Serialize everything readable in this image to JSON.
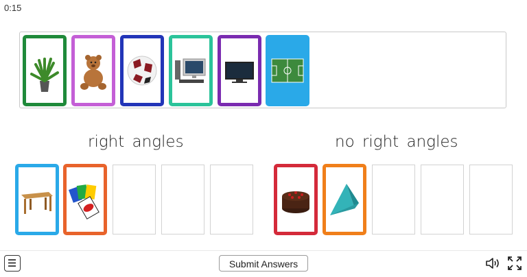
{
  "timer": "0:15",
  "categories": {
    "left_title": "right angles",
    "right_title": "no right angles"
  },
  "pool_cards": [
    {
      "name": "plant",
      "border": "#1f8a3a"
    },
    {
      "name": "teddy-bear",
      "border": "#c45fd6"
    },
    {
      "name": "soccer-ball",
      "border": "#2235b8"
    },
    {
      "name": "desktop-computer",
      "border": "#2bc39a"
    },
    {
      "name": "flat-screen-tv",
      "border": "#7a2bb0"
    },
    {
      "name": "soccer-field",
      "border": "#2aa9e8"
    }
  ],
  "right_angles_cards": [
    {
      "name": "wooden-table",
      "border": "#2aa9e8"
    },
    {
      "name": "uno-cards",
      "border": "#e8632b"
    }
  ],
  "no_right_angles_cards": [
    {
      "name": "chocolate-cake",
      "border": "#d42a3a"
    },
    {
      "name": "triangular-pyramid",
      "border": "#f07f1a"
    }
  ],
  "footer": {
    "submit_label": "Submit Answers",
    "menu_icon": "menu-icon",
    "sound_icon": "speaker-icon",
    "fullscreen_icon": "fullscreen-icon"
  }
}
